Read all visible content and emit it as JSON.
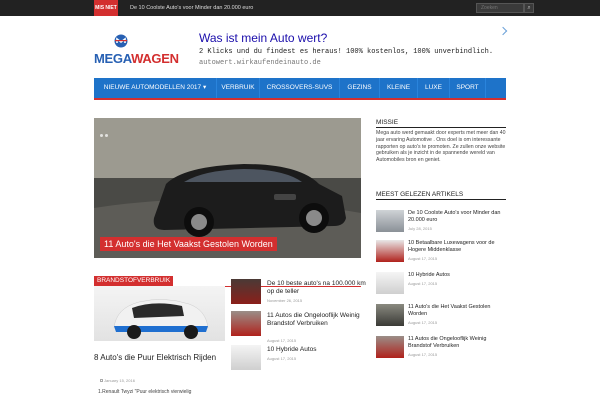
{
  "topbar": {
    "badge": "MIS NIET",
    "ticker": "De 10 Coolste Auto's voor Minder dan 20.000 euro",
    "search_placeholder": "Zoeken",
    "search_icon": "search-icon"
  },
  "logo": {
    "part1": "MEGA",
    "part2": "WAGEN"
  },
  "ad": {
    "title": "Was ist mein Auto wert?",
    "description": "2 Klicks und du findest es heraus! 100% kostenlos, 100% unverbindlich.",
    "url": "autowert.wirkaufendeinauto.de",
    "arrow_icon": "chevron-right-icon"
  },
  "nav": {
    "items": [
      {
        "label": "NIEUWE AUTOMODELLEN 2017 ▾"
      },
      {
        "label": "VERBRUIK"
      },
      {
        "label": "CROSSOVERS-SUVS"
      },
      {
        "label": "GEZINS"
      },
      {
        "label": "KLEINE"
      },
      {
        "label": "LUXE"
      },
      {
        "label": "SPORT"
      }
    ]
  },
  "slider": {
    "caption": "11 Auto's die Het Vaakst Gestolen Worden"
  },
  "section": {
    "title": "BRANDSTOFVERBRUIK"
  },
  "main_post": {
    "title": "8 Auto's die Puur Elektrisch Rijden",
    "date": "January 15, 2016",
    "excerpt": "1.Renault Twyzi \"Puur elektrisch vierwielig"
  },
  "side_posts": [
    {
      "title": "De 10 beste auto's na 100.000 km op de teller",
      "date": "November 26, 2015"
    },
    {
      "title": "11 Autos die Ongelooflijk Weinig Brandstof Verbruiken",
      "date": "August 17, 2015"
    },
    {
      "title": "10 Hybride Autos",
      "date": "August 17, 2015"
    }
  ],
  "missie": {
    "title": "MISSIE",
    "text": "Mega auto werd gemaakt door experts met meer dan 40 jaar ervaring Automotive . Ons doel is om interessante rapporten op auto's te promoten. Ze zullen onze website gebruiken als je inzicht in de spannende wereld van Automobiles bron en geniet."
  },
  "popular": {
    "title": "MEEST GELEZEN ARTIKELS",
    "items": [
      {
        "title": "De 10 Coolste Auto's voor Minder dan 20.000 euro",
        "date": "July 28, 2015"
      },
      {
        "title": "10 Betaalbare Luxewagens voor de Hogere Middenklasse",
        "date": "August 17, 2015"
      },
      {
        "title": "10 Hybride Autos",
        "date": "August 17, 2015"
      },
      {
        "title": "11 Auto's die Het Vaakst Gestolen Worden",
        "date": "August 17, 2015"
      },
      {
        "title": "11 Autos die Ongelooflijk Weinig Brandstof Verbruiken",
        "date": "August 17, 2015"
      }
    ]
  },
  "colors": {
    "accent": "#d32f2f",
    "nav": "#1e73c9",
    "topbar": "#222222"
  }
}
